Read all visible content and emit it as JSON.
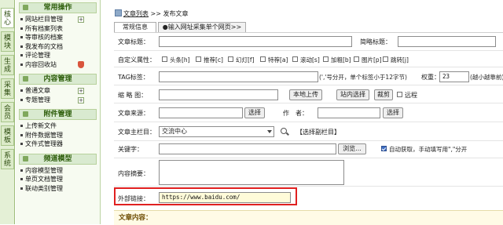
{
  "vertical_tabs": [
    "核心",
    "模块",
    "生成",
    "采集",
    "会员",
    "模板",
    "系统"
  ],
  "sidebar": {
    "groups": [
      {
        "title": "常用操作",
        "items": [
          "网站栏目管理",
          "所有档案列表",
          "等审核的档案",
          "我发布的文档",
          "评论管理",
          "内容回收站"
        ]
      },
      {
        "title": "内容管理",
        "items": [
          "普通文章",
          "专题管理"
        ]
      },
      {
        "title": "附件管理",
        "items": [
          "上传新文件",
          "附件数据管理",
          "文件式管理器"
        ]
      },
      {
        "title": "频道模型",
        "items": [
          "内容模型管理",
          "单页文档管理",
          "联动类别管理"
        ]
      }
    ]
  },
  "breadcrumb": {
    "link": "文章列表",
    "sep": ">>",
    "current": "发布文章"
  },
  "tabs": [
    "常规信息",
    "●输入网址采集单个网页>>"
  ],
  "form": {
    "title_label": "文章标题：",
    "short_title_label": "简略标题：",
    "attr_label": "自定义属性：",
    "attributes": [
      "头条[h]",
      "推荐[c]",
      "幻灯[f]",
      "特荐[a]",
      "滚动[s]",
      "加粗[b]",
      "图片[p]",
      "跳转[j]"
    ],
    "tag_label": "TAG标签：",
    "tag_hint": "(','号分开，单个标签小于12字节)",
    "weight_label": "权重：",
    "weight_value": "23",
    "weight_hint": "(越小越靠前)",
    "thumb_label": "缩 略 图：",
    "upload_btn": "本地上传",
    "site_select_btn": "站内选择",
    "crop_btn": "裁剪",
    "remote_label": "远程",
    "source_label": "文章来源：",
    "select_btn": "选择",
    "author_label": "作　者：",
    "column_label": "文章主栏目：",
    "column_value": "交流中心",
    "sub_column_link": "【选择副栏目】",
    "keywords_label": "关键字：",
    "browse_btn": "浏览...",
    "auto_fetch_label": "自动获取，手动填写用\",\"分开",
    "summary_label": "内容摘要：",
    "ext_link_label": "外部链接：",
    "ext_link_value": "https://www.baidu.com/",
    "content_head": "文章内容："
  }
}
